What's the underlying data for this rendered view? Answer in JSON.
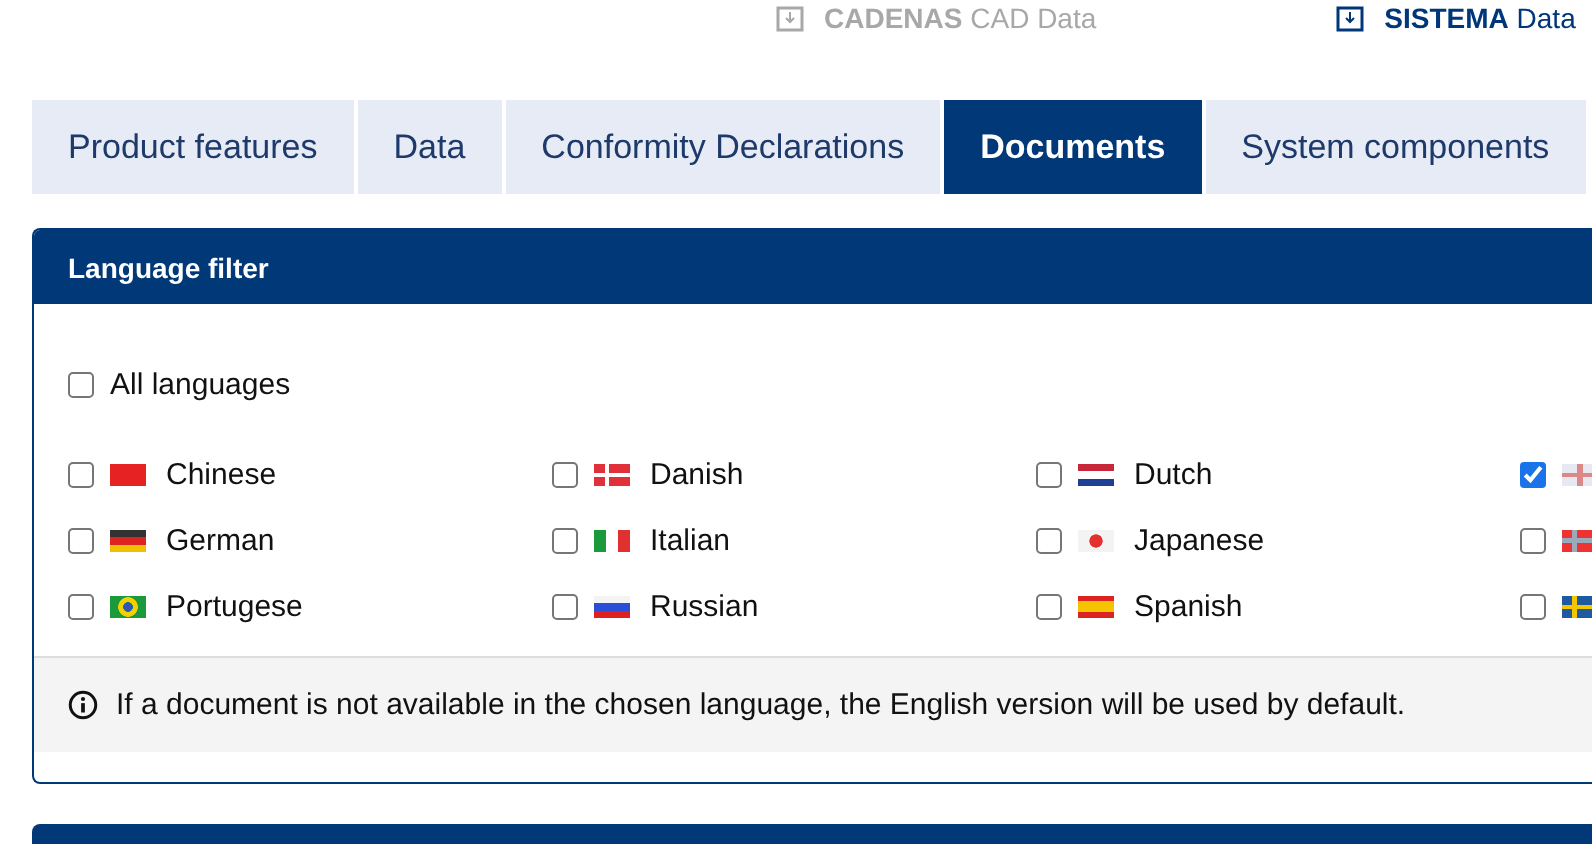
{
  "top_links": [
    {
      "text": "**CADENAS** CAD Data",
      "kind": "muted"
    },
    {
      "text": "**SISTEMA** Data",
      "kind": "strong"
    }
  ],
  "tabs": [
    {
      "label": "Product features",
      "selected": false
    },
    {
      "label": "Data",
      "selected": false
    },
    {
      "label": "Conformity Declarations",
      "selected": false
    },
    {
      "label": "Documents",
      "selected": true
    },
    {
      "label": "System components",
      "selected": false
    }
  ],
  "language_filter": {
    "title": "Language filter",
    "all_languages": {
      "label": "All languages",
      "checked": false
    },
    "languages": [
      {
        "label": "Chinese",
        "kind": "cn",
        "checked": false
      },
      {
        "label": "Danish",
        "kind": "dk",
        "checked": false
      },
      {
        "label": "Dutch",
        "kind": "nl",
        "checked": false
      },
      {
        "kind": "gb",
        "checked": true
      },
      {
        "label": "German",
        "kind": "de",
        "checked": false
      },
      {
        "label": "Italian",
        "kind": "it",
        "checked": false
      },
      {
        "label": "Japanese",
        "kind": "jp",
        "checked": false
      },
      {
        "kind": "no",
        "checked": false
      },
      {
        "label": "Portugese",
        "kind": "br",
        "checked": false
      },
      {
        "label": "Russian",
        "kind": "ru",
        "checked": false
      },
      {
        "label": "Spanish",
        "kind": "es",
        "checked": false
      },
      {
        "kind": "se",
        "checked": false
      }
    ],
    "note": "If a document is not available in the chosen language, the English version will be used by default."
  }
}
